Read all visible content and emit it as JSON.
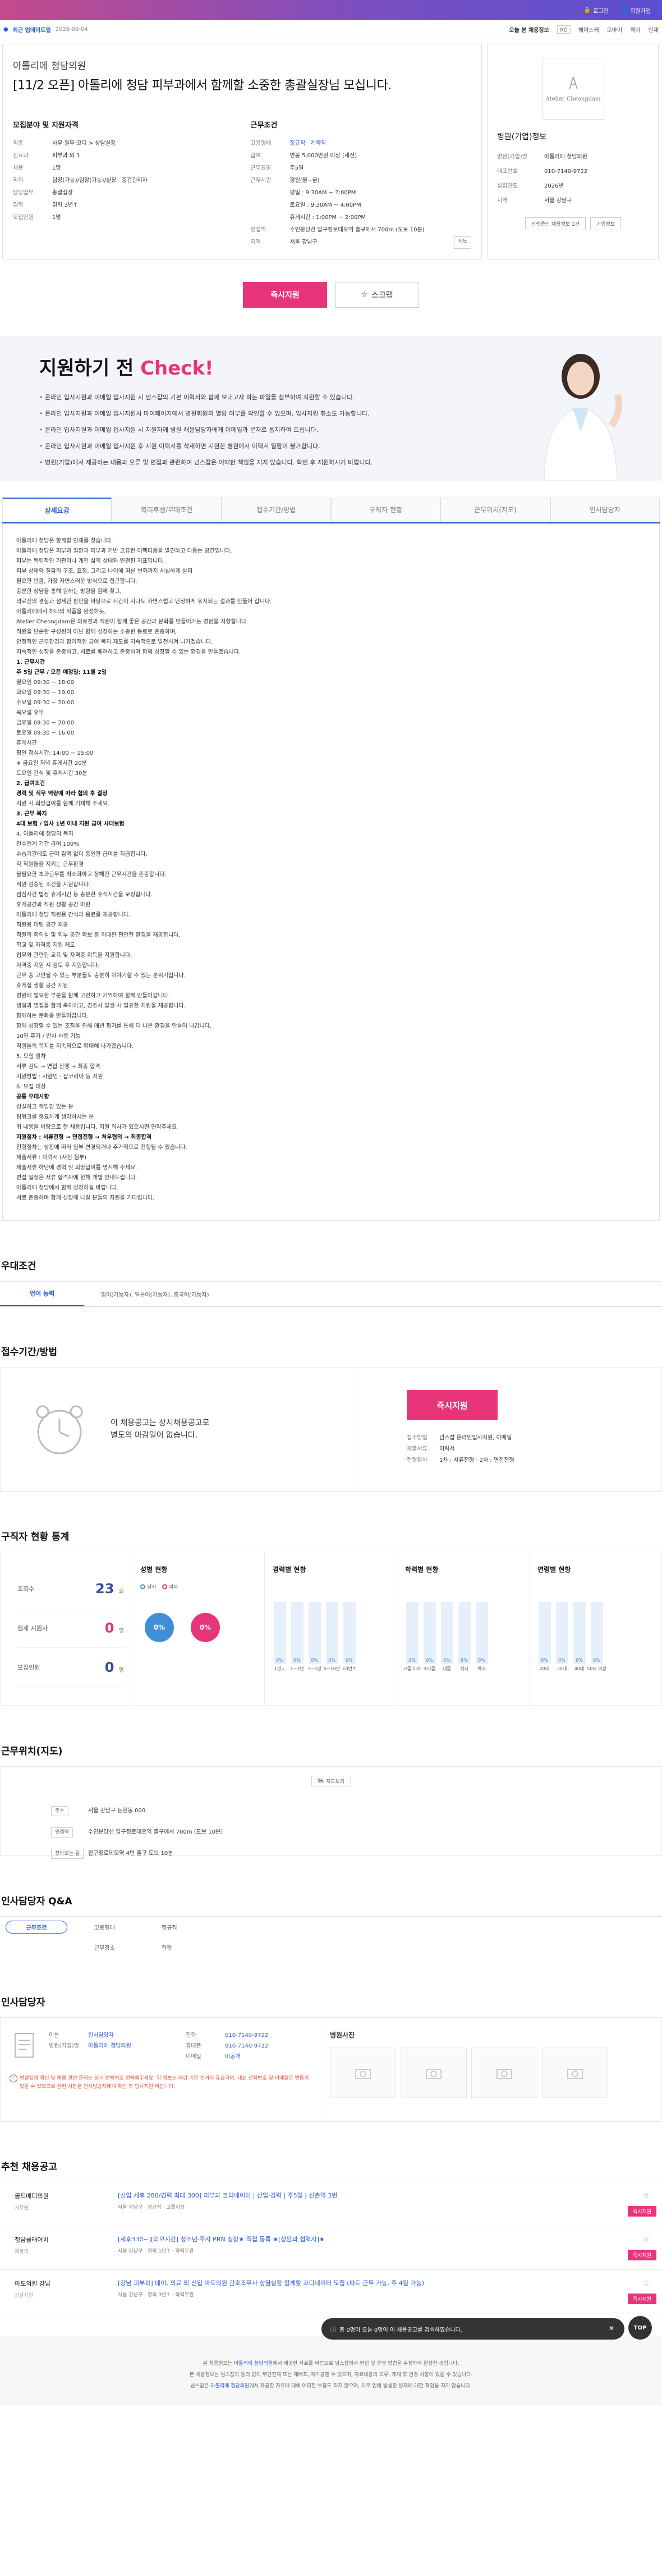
{
  "header": {
    "login": "로그인",
    "join": "회원가입"
  },
  "subbar": {
    "label": "최근 업데이트일",
    "date": "2026-09-04",
    "today": "오늘 본 채용정보",
    "today_count": "0건",
    "links": [
      "헤어스케",
      "모바이",
      "팩비",
      "인재"
    ]
  },
  "job": {
    "company": "아톨리에 청담의원",
    "title": "[11/2 오픈] 아톨리에 청담 피부과에서 함께할 소중한 총괄실장님 모십니다.",
    "recruit": {
      "heading": "모집분야 및 지원자격",
      "rows": [
        {
          "k": "직종",
          "v": "사무·원무·코디 > 상담실장"
        },
        {
          "k": "진료과",
          "v": "피부과 외 1"
        },
        {
          "k": "채용",
          "v": "1명"
        },
        {
          "k": "직위",
          "v": "팀장(가능)/팀장(가능)/실장 · 중간관리자"
        },
        {
          "k": "담당업무",
          "v": "총괄실장"
        },
        {
          "k": "경력",
          "v": "경력 3년↑"
        },
        {
          "k": "모집인원",
          "v": "1명"
        }
      ]
    },
    "conditions": {
      "heading": "근무조건",
      "rows": [
        {
          "k": "고용형태",
          "v": "정규직 · 계약직",
          "blue": true
        },
        {
          "k": "급여",
          "v": "연봉 5,000만원 이상 (세전)"
        },
        {
          "k": "근무요일",
          "v": "주5일"
        },
        {
          "k": "근무시간",
          "v": "평일(월~금)\n평일 : 9:30AM ~ 7:00PM\n토요일 : 9:30AM ~ 4:00PM\n휴게시간 : 1:00PM ~ 2:00PM"
        },
        {
          "k": "인접역",
          "v": "수인분당선 압구정로데오역 출구에서 700m (도보 10분)"
        },
        {
          "k": "지역",
          "v": "서울 강남구",
          "tag": "지도"
        }
      ]
    }
  },
  "side": {
    "heading": "병원(기업)정보",
    "logo_text": "Atelier Cheongdam",
    "rows": [
      {
        "k": "병원(기업)명",
        "v": "아톨리에 청담의원"
      },
      {
        "k": "대표번호",
        "v": "010-7140-9722"
      },
      {
        "k": "설립연도",
        "v": "2026년"
      },
      {
        "k": "지역",
        "v": "서울 강남구"
      }
    ],
    "btn1": "진행중인 채용정보 1건",
    "btn2": "기업정보"
  },
  "actions": {
    "apply": "즉시지원",
    "scrap": "스크랩"
  },
  "check": {
    "title_a": "지원하기 전 ",
    "title_b": "Check!",
    "items": [
      "온라인 입사지원과 이메일 입사지원 시 넘스잡의 기본 이력서와 함께 보내고자 하는 파일을 첨부하여 지원할 수 있습니다.",
      "온라인 입사지원과 이메일 입사지원시 마이페이지에서 병원회원의 열람 여부를 확인할 수 있으며, 입사지원 취소도 가능합니다.",
      "온라인 입사지원과 이메일 입사지원 시 지원자께 병원 채용담당자에게 이메일과 문자로 통지하여 드립니다.",
      "온라인 입사지원과 이메일 입사지원 후 지원 이력서를 삭제하면 지원한 병원에서 이력서 열람이 불가합니다.",
      "병원(기업)에서 제공하는 내용과 오류 및 면접과 관련하여 넘스잡은 어떠한 책임을 지지 않습니다. 확인 후 지원하시기 바랍니다."
    ]
  },
  "tabs": [
    "상세요강",
    "복리후생/우대조건",
    "접수기간/방법",
    "구직자 현황",
    "근무위치(지도)",
    "인사담당자"
  ],
  "detail": [
    {
      "t": "아톨리에 청담은 함께할 인재를 찾습니다."
    },
    {
      "t": "아톨리에 청담은 피부과 질환과 피부과 기반 고유한 이펙티움을 발견하고 다듬는 공간입니다."
    },
    {
      "t": "피부는 독립적인 기관이나 개인 삶의 상태와 연결된 지표입니다."
    },
    {
      "t": "피부 상태와 질감의 구조, 표정, 그리고 나이에 따른 변화까지 세심하게 살펴"
    },
    {
      "t": "필요한 만큼, 가장 자연스러운 방식으로 접근합니다."
    },
    {
      "t": "충분한 상담을 통해 원하는 방향을 함께 찾고,"
    },
    {
      "t": "의료진의 경험과 섬세한 판단을 바탕으로 시간이 지나도 자연스럽고 단정하게 유지되는 결과를 만들어 갑니다."
    },
    {
      "t": "아톨리에에서 하나의 작품을 완성하듯,"
    },
    {
      "t": "Atelier Cheongdam은 의료진과 직원이 함께 좋은 공간과 문화를 만들어가는 병원을 지향합니다."
    },
    {
      "t": "직원을 단순한 구성원이 아닌 함께 성장하는 소중한 동료로 존중하며,"
    },
    {
      "t": "안정적인 근무환경과 합리적인 급여 복지 제도를 지속적으로 발전시켜 나가겠습니다."
    },
    {
      "t": "지속적인 성장을 존중하고, 서로를 배려하고 존중하며 함께 성장할 수 있는 환경을 만들겠습니다."
    },
    {
      "t": "1. 근무시간",
      "b": true
    },
    {
      "t": "주 5일 근무 / 오픈 예정일: 11월 2일",
      "b": true
    },
    {
      "t": "월요일 09:30 ~ 18:00"
    },
    {
      "t": "화요일 09:30 ~ 19:00"
    },
    {
      "t": "수요일 09:30 ~ 20:00"
    },
    {
      "t": "목요일 휴무"
    },
    {
      "t": "금요일 09:30 ~ 20:00"
    },
    {
      "t": "토요일 09:30 ~ 16:00"
    },
    {
      "t": "휴게시간"
    },
    {
      "t": "평일 점심시간: 14:00 ~ 15:00"
    },
    {
      "t": "※ 금요일 저녁 휴게시간 20분"
    },
    {
      "t": "토요일 간식 및 휴게시간 30분"
    },
    {
      "t": "2. 급여조건",
      "b": true
    },
    {
      "t": "경력 및 직무 역량에 따라 협의 후 결정",
      "b": true
    },
    {
      "t": "지원 시 희망급여를 함께 기재해 주세요."
    },
    {
      "t": "3. 근무 복지",
      "b": true
    },
    {
      "t": "4대 보험 / 입사 1년 이내 지원 급여 사대보험",
      "b": true
    },
    {
      "t": "4. 아톨리에 청담의 복지"
    },
    {
      "t": "인수인계 기간 급여 100%"
    },
    {
      "t": "수습기간에도 급여 감액 없이 동일한 급여를 지급합니다."
    },
    {
      "t": "각 직원들을 지키는 근무환경"
    },
    {
      "t": "불필요한 초과근무를 최소화하고 정해진 근무시간을 존중합니다."
    },
    {
      "t": "직원 검증된 조건을 지원합니다."
    },
    {
      "t": "점심시간 법정 휴게시간 등 충분한 휴식시간을 보장합니다."
    },
    {
      "t": "휴게공간과 직원 생활 공간 마련"
    },
    {
      "t": "아톨리에 청담 직원용 간식과 음료를 제공합니다."
    },
    {
      "t": "직원용 미팅 공간 제공"
    },
    {
      "t": "직원의 회의실 및 외부 공간 확보 등 최대한 편안한 환경을 제공합니다."
    },
    {
      "t": "학교 및 자격증 지원 제도"
    },
    {
      "t": "업무와 관련된 교육 및 자격증 취득을 지원합니다."
    },
    {
      "t": "자격증 지원 시 검토 후 지원합니다."
    },
    {
      "t": "근무 중 고민될 수 있는 부분들도 충분히 이야기할 수 있는 분위기입니다."
    },
    {
      "t": "휴게실 생활 공간 지원"
    },
    {
      "t": "병원에 필요한 부분을 함께 고민하고 기억하며 함께 만들어갑니다."
    },
    {
      "t": "생일과 명절을 함께 축하하고, 경조사 발생 시 필요한 지원을 제공합니다."
    },
    {
      "t": "함께하는 문화를 만들어갑니다."
    },
    {
      "t": "함께 성장할 수 있는 조직을 위해 매년 평가를 통해 더 나은 환경을 만들어 나갑니다."
    },
    {
      "t": "10일 휴가 / 반차 사용 가능"
    },
    {
      "t": "직원들의 복지를 지속적으로 확대해 나가겠습니다."
    },
    {
      "t": "5. 모집 절차"
    },
    {
      "t": "서류 검토 → 면접 진행 → 최종 합격"
    },
    {
      "t": "지원방법 : 사람인 · 잡코리아 등 지원"
    },
    {
      "t": "6. 모집 대상"
    },
    {
      "t": "공통 우대사항",
      "b": true
    },
    {
      "t": "성실하고 책임감 있는 분"
    },
    {
      "t": "팀워크를 중요하게 생각하시는 분"
    },
    {
      "t": "위 내용을 바탕으로 한 채용입니다. 지원 의사가 있으시면 연락주세요"
    },
    {
      "t": "지원절차 : 서류전형 → 면접전형 → 처우협의 → 최종합격",
      "b": true
    },
    {
      "t": "전형절차는 상황에 따라 일부 변경되거나 추가적으로 진행될 수 있습니다."
    },
    {
      "t": "제출서류 : 이력서 (사진 첨부)"
    },
    {
      "t": "제출서류 하단에 경력 및 희망급여를 명시해 주세요."
    },
    {
      "t": "면접 일정은 서류 합격자에 한해 개별 안내드립니다."
    },
    {
      "t": "아톨리에 청담에서 함께 성장하길 바랍니다."
    },
    {
      "t": "서로 존중하며 함께 성장해 나갈 분들의 지원을 기다립니다."
    }
  ],
  "benefit": {
    "heading": "우대조건",
    "tab": "언어 능력",
    "value": "영어(가능자), 일본어(가능자), 중국어(가능자)"
  },
  "howto": {
    "heading": "접수기간/방법",
    "msg_a": "이 채용공고는 상시채용공고로",
    "msg_b": "별도의 마감일이 없습니다.",
    "apply": "즉시지원",
    "rows": [
      {
        "k": "접수방법",
        "v": "넘스잡 온라인입사지원, 이메일"
      },
      {
        "k": "제출서류",
        "v": "이력서"
      },
      {
        "k": "전형절차",
        "v": "1차 : 서류전형 · 2차 : 면접전형"
      }
    ]
  },
  "stats": {
    "heading": "구직자 현황 통계",
    "summary": [
      {
        "k": "조회수",
        "v": "23",
        "u": "회",
        "pink": false
      },
      {
        "k": "현재 지원자",
        "v": "0",
        "u": "명",
        "pink": true
      },
      {
        "k": "모집인원",
        "v": "0",
        "u": "명",
        "pink": false
      }
    ],
    "gender": {
      "title": "성별 현황",
      "legend": [
        "남자",
        "여자"
      ],
      "values": [
        "0%",
        "0%"
      ]
    },
    "career": {
      "title": "경력별 현황",
      "labels": [
        "1년↓",
        "1~3년",
        "3~5년",
        "5~10년",
        "10년↑"
      ],
      "values": [
        0,
        0,
        0,
        0,
        0
      ]
    },
    "edu": {
      "title": "학력별 현황",
      "labels": [
        "고졸 이하",
        "초대졸",
        "대졸",
        "석사",
        "박사"
      ],
      "values": [
        0,
        0,
        0,
        0,
        0
      ]
    },
    "age": {
      "title": "연령별 현황",
      "labels": [
        "20대",
        "30대",
        "40대",
        "50대 이상"
      ],
      "values": [
        0,
        0,
        0,
        0
      ]
    }
  },
  "location": {
    "heading": "근무위치(지도)",
    "map_btn": "지도보기",
    "rows": [
      {
        "k": "주소",
        "v": "서울 강남구 논현동 000"
      },
      {
        "k": "인접역",
        "v": "수인분당선 압구정로데오역 출구에서 700m (도보 10분)"
      },
      {
        "k": "찾아오는 길",
        "v": "압구정로데오역 4번 출구 도보 10분"
      }
    ]
  },
  "qa": {
    "heading": "인사담당자 Q&A",
    "row1": [
      "근무조건",
      "고용형태",
      "정규직"
    ],
    "row2": [
      "근무장소",
      "현황"
    ]
  },
  "hr": {
    "heading": "인사담당자",
    "rows_l": [
      {
        "k": "이름",
        "v": "인사담당자"
      },
      {
        "k": "병원(기업)명",
        "v": "아톨리에 청담의원"
      }
    ],
    "rows_r": [
      {
        "k": "전화",
        "v": "010-7140-9722"
      },
      {
        "k": "휴대폰",
        "v": "010-7140-9722"
      },
      {
        "k": "이메일",
        "v": "비공개"
      }
    ],
    "note": "면접일정 확인 및 채용 관련 문의는 상기 연락처로 연락해주세요. 위 정보는 마감 기한 전까지 유효하며, 대표 전화번호 및 이메일은 변동이 있을 수 있으므로 관련 사항은 인사담당자에게 확인 후 입사지원 바랍니다.",
    "photo_title": "병원사진"
  },
  "recommend": {
    "heading": "추천 채용공고",
    "items": [
      {
        "co": "골드메디의원",
        "sub": "사무원",
        "title": "[신입 세후 280/경력 최대 300] 피부과 코디네이터 | 신입·경력 | 주5일 | 신촌역 3번",
        "meta": "서울 강남구 · 정규직 · 고졸이상",
        "apply": "즉시지원"
      },
      {
        "co": "청담클래어치",
        "sub": "재활의",
        "title": "[세후330~][리모시간] 청소년·주사 PRN 실장★ 직접 등록 ★[상담과 협력자]★",
        "meta": "서울 강남구 · 경력 1년↑ · 학력무관",
        "apply": "즉시지원"
      },
      {
        "co": "아도의원 강남",
        "sub": "상담사원",
        "title": "[강남 피부과] 데이, 의료 외 신입 아도의원 간호조무사 상담실장 함께할 코디네이터 모집 (파트 근무 가능, 주 4일 가능)",
        "meta": "서울 강남구 · 경력 3년↑ · 학력무관",
        "apply": "즉시지원"
      }
    ]
  },
  "footer": {
    "line1a": "본 채용정보는 ",
    "line1b": "아톨리에 청담의원",
    "line1c": "에서 제공한 자료를 바탕으로 넘스잡에서 편집 및 운영 방법을 수정하여 완성한 것입니다.",
    "line2": "본 채용정보는 넘스잡의 동의 없이 무단전재 또는 재배포, 재가공할 수 없으며, 자료내용의 오류, 게재 후 변경 사항이 있을 수 있습니다.",
    "line3a": "넘스잡은 ",
    "line3b": "아톨리에 청담의원",
    "line3c": "에서 제공한 자료에 대해 어떠한 보증도 하지 않으며, 이로 인해 발생한 문제에 대한 책임을 지지 않습니다."
  },
  "float": {
    "msg": "총 0명이 오늘 0명이 이 채용공고를 검색하였습니다.",
    "top": "TOP"
  }
}
